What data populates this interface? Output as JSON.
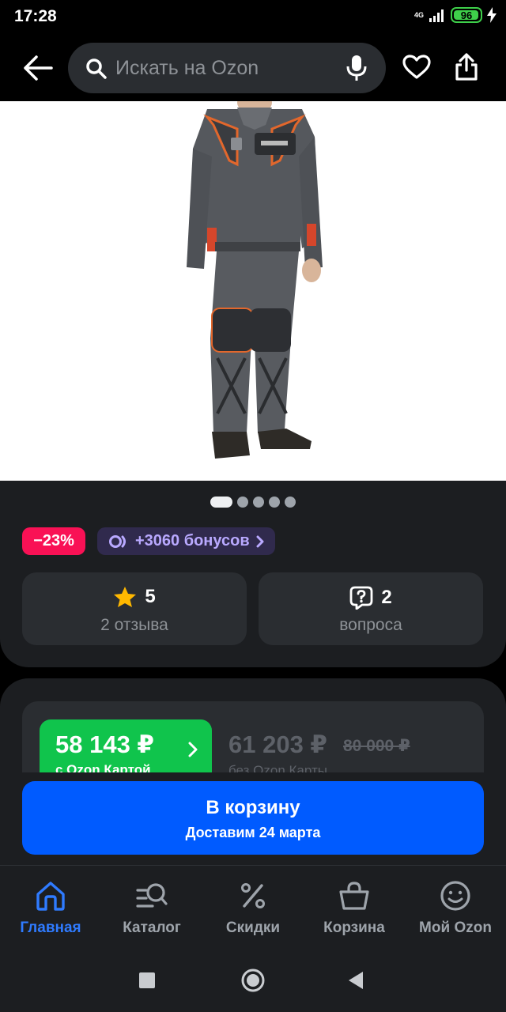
{
  "status_bar": {
    "time": "17:28",
    "network": "4G",
    "battery": "96",
    "battery_level": 0.96
  },
  "header": {
    "search_placeholder": "Искать на Ozon",
    "icons": [
      "back-arrow-icon",
      "search-icon",
      "microphone-icon",
      "heart-icon",
      "share-icon"
    ]
  },
  "product": {
    "image_description_icon": "product-photo",
    "gallery_count": 5,
    "gallery_active": 0,
    "discount": "−23%",
    "bonus": "+3060 бонусов",
    "rating": "5",
    "reviews_label": "2 отзыва",
    "questions_count": "2",
    "questions_label": "вопроса"
  },
  "price": {
    "card_price": "58 143 ₽",
    "card_price_sub": "с Ozon Картой",
    "regular_price": "61 203 ₽",
    "old_price": "80 000 ₽",
    "regular_sub": "без Ozon Карты"
  },
  "cart": {
    "label": "В корзину",
    "delivery": "Доставим 24 марта"
  },
  "bottom_nav": {
    "items": [
      {
        "label": "Главная",
        "icon": "home-icon",
        "active": true
      },
      {
        "label": "Каталог",
        "icon": "catalog-search-icon",
        "active": false
      },
      {
        "label": "Скидки",
        "icon": "percent-icon",
        "active": false
      },
      {
        "label": "Корзина",
        "icon": "basket-icon",
        "active": false
      },
      {
        "label": "Мой Ozon",
        "icon": "smiley-icon",
        "active": false
      }
    ]
  },
  "colors": {
    "accent_blue": "#005bff",
    "active_nav": "#2f7bff",
    "discount_pink": "#f91155",
    "price_green": "#10c44c",
    "bonus_purple": "#b9a9ff",
    "star_yellow": "#ffb800"
  }
}
